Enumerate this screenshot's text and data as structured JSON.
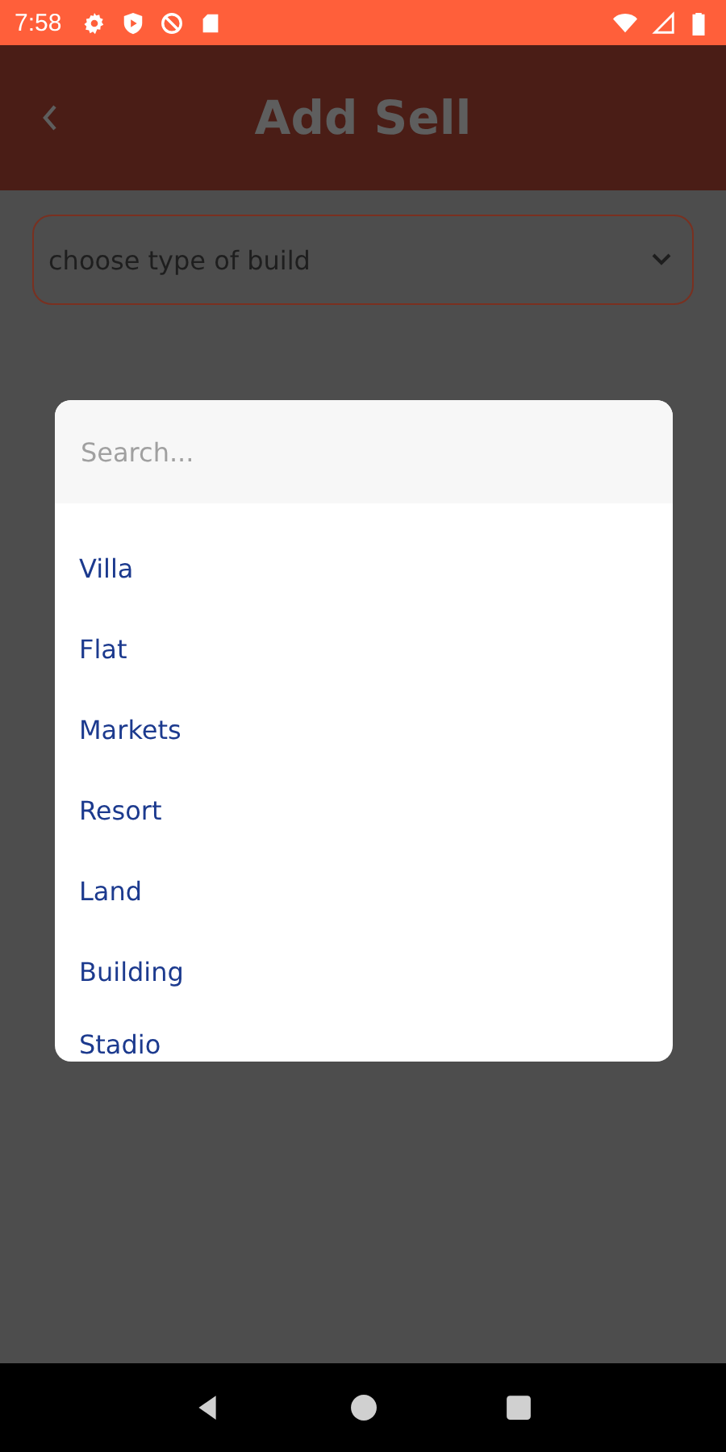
{
  "status_bar": {
    "time": "7:58"
  },
  "app_bar": {
    "title": "Add Sell"
  },
  "type_dropdown": {
    "placeholder": "choose type of build"
  },
  "dialog": {
    "search": {
      "placeholder": "Search..."
    },
    "options": [
      {
        "label": "Villa"
      },
      {
        "label": "Flat"
      },
      {
        "label": "Markets"
      },
      {
        "label": "Resort"
      },
      {
        "label": "Land"
      },
      {
        "label": "Building"
      },
      {
        "label": "Stadio"
      }
    ]
  }
}
